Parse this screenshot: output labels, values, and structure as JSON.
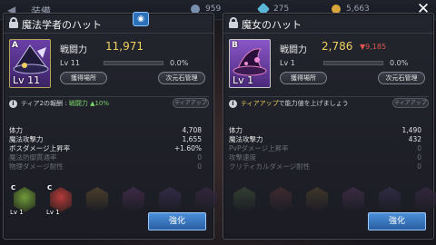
{
  "topbar": {
    "title": "装備",
    "resources": [
      "959",
      "275",
      "5,663"
    ]
  },
  "left": {
    "name": "魔法学者のハット",
    "grade": "A",
    "level_badge": "Lv 11",
    "cp_label": "戦闘力",
    "cp_value": "11,971",
    "level_label": "Lv 11",
    "exp_percent": "0.0%",
    "exp_fraction": 0.0,
    "btn_obtain": "獲得場所",
    "btn_dimension": "次元石管理",
    "tier_prefix": "ティア2の報酬 : ",
    "tier_bonus": "戦闘力 ▲10%",
    "tier_btn": "ティアアップ",
    "stats": [
      {
        "label": "体力",
        "value": "4,708",
        "dim": false
      },
      {
        "label": "魔法攻撃力",
        "value": "1,655",
        "dim": false
      },
      {
        "label": "ボスダメージ上昇率",
        "value": "+1.60%",
        "dim": false
      },
      {
        "label": "魔法防御貫通率",
        "value": "0",
        "dim": true
      },
      {
        "label": "物理ダメージ耐性",
        "value": "0",
        "dim": true
      }
    ],
    "slots": [
      {
        "grade": "C",
        "level": "Lv 1",
        "color": "#6f9a3a",
        "active": true
      },
      {
        "grade": "C",
        "level": "Lv 1",
        "color": "#b53a3a",
        "active": true
      },
      {
        "grade": "",
        "level": "",
        "color": "#5a4a2c",
        "active": false
      },
      {
        "grade": "",
        "level": "",
        "color": "#4a2f52",
        "active": false
      },
      {
        "grade": "",
        "level": "",
        "color": "#3a2f52",
        "active": false
      },
      {
        "grade": "",
        "level": "",
        "color": "#3a2a45",
        "active": false
      }
    ],
    "enhance": "強化"
  },
  "right": {
    "name": "魔女のハット",
    "grade": "B",
    "level_badge": "Lv 1",
    "cp_label": "戦闘力",
    "cp_value": "2,786",
    "cp_diff": "▼9,185",
    "level_label": "Lv 1",
    "exp_percent": "0.0%",
    "exp_fraction": 0.0,
    "btn_obtain": "獲得場所",
    "btn_dimension": "次元石管理",
    "tier_prefix": "ティアアップ",
    "tier_suffix": "で能力値を上げましょう",
    "tier_btn": "ティアアップ",
    "stats": [
      {
        "label": "体力",
        "value": "1,490",
        "dim": false
      },
      {
        "label": "魔法攻撃力",
        "value": "432",
        "dim": false
      },
      {
        "label": "PvPダメージ上昇率",
        "value": "0",
        "dim": true
      },
      {
        "label": "攻撃速度",
        "value": "0",
        "dim": true
      },
      {
        "label": "クリティカルダメージ耐性",
        "value": "0",
        "dim": true
      }
    ],
    "slots": [
      {
        "color": "#3a4a36"
      },
      {
        "color": "#4a3034"
      },
      {
        "color": "#4a3f2c"
      },
      {
        "color": "#46304e"
      },
      {
        "color": "#36304e"
      },
      {
        "color": "#3a2a45"
      }
    ],
    "enhance": "強化"
  }
}
